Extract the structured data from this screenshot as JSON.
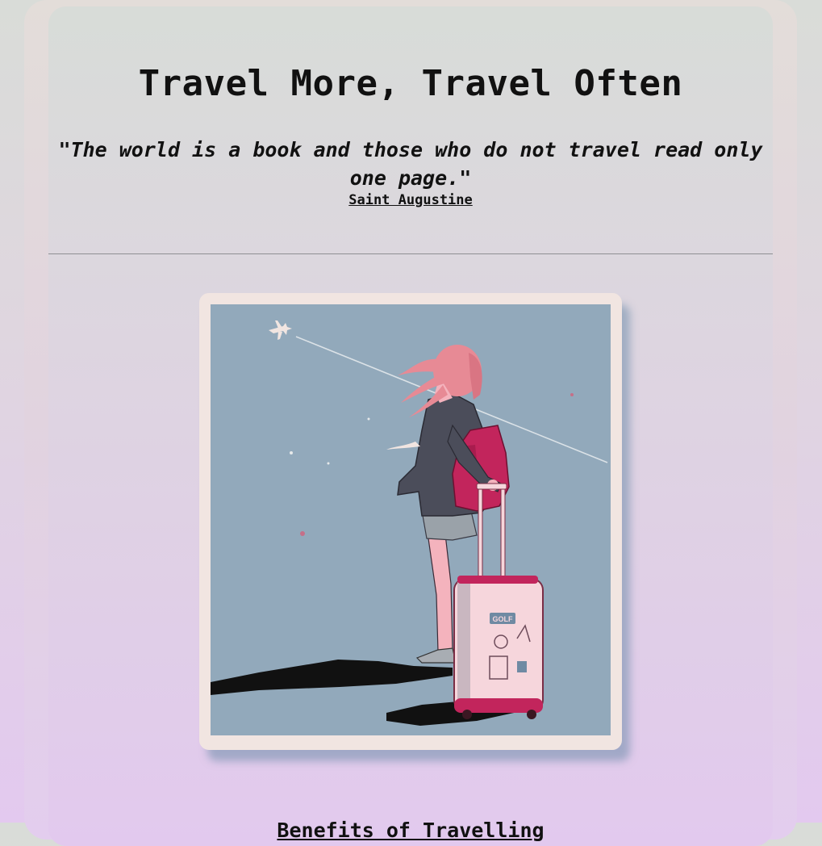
{
  "header": {
    "title": "Travel More, Travel Often",
    "quote": "\"The world is a book and those who do not travel read only one page.\"",
    "author": "Saint Augustine"
  },
  "image": {
    "subject": "travel-girl-illustration-icon",
    "sticker_text": "GOLF"
  },
  "section": {
    "heading": "Benefits of Travelling"
  },
  "colors": {
    "sky": "#92a9bb",
    "frame": "#f1e5e1",
    "hair": "#e78a95",
    "bag": "#c2255c",
    "suitcase": "#f6d6dc"
  }
}
